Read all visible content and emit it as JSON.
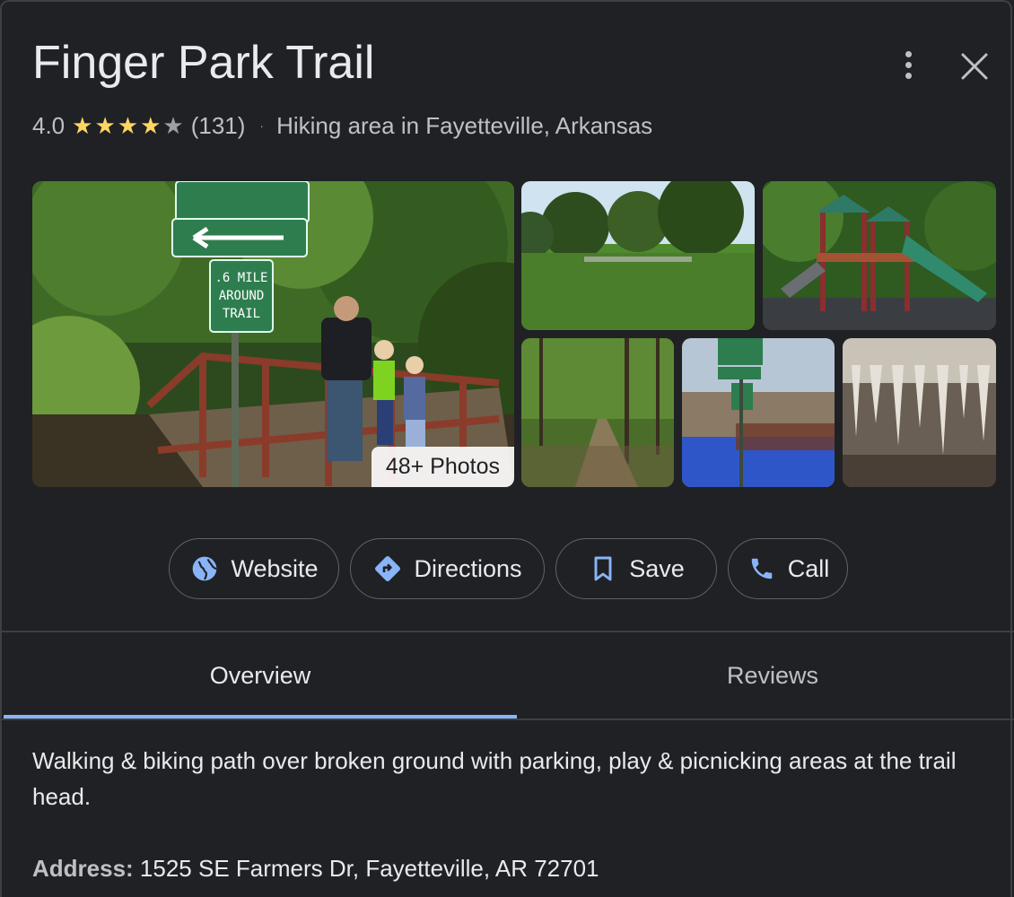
{
  "place": {
    "title": "Finger Park Trail",
    "rating": "4.0",
    "rating_stars": 4,
    "rating_max": 5,
    "review_count": "(131)",
    "separator": "·",
    "category": "Hiking area in Fayetteville, Arkansas"
  },
  "photos": {
    "badge": "48+ Photos",
    "sign_text": ".6 MILE AROUND TRAIL"
  },
  "actions": {
    "website": "Website",
    "directions": "Directions",
    "save": "Save",
    "call": "Call"
  },
  "tabs": {
    "overview": "Overview",
    "reviews": "Reviews"
  },
  "overview": {
    "description": "Walking & biking path over broken ground with parking, play & picnicking areas at the trail head.",
    "address_label": "Address:",
    "address_value": " 1525 SE Farmers Dr, Fayetteville, AR 72701"
  },
  "colors": {
    "background": "#202124",
    "accent": "#8ab4f8",
    "star": "#fdd663"
  },
  "icons": {
    "more": "more-vert-icon",
    "close": "close-icon",
    "website": "globe-icon",
    "directions": "directions-icon",
    "save": "bookmark-icon",
    "call": "phone-icon"
  }
}
